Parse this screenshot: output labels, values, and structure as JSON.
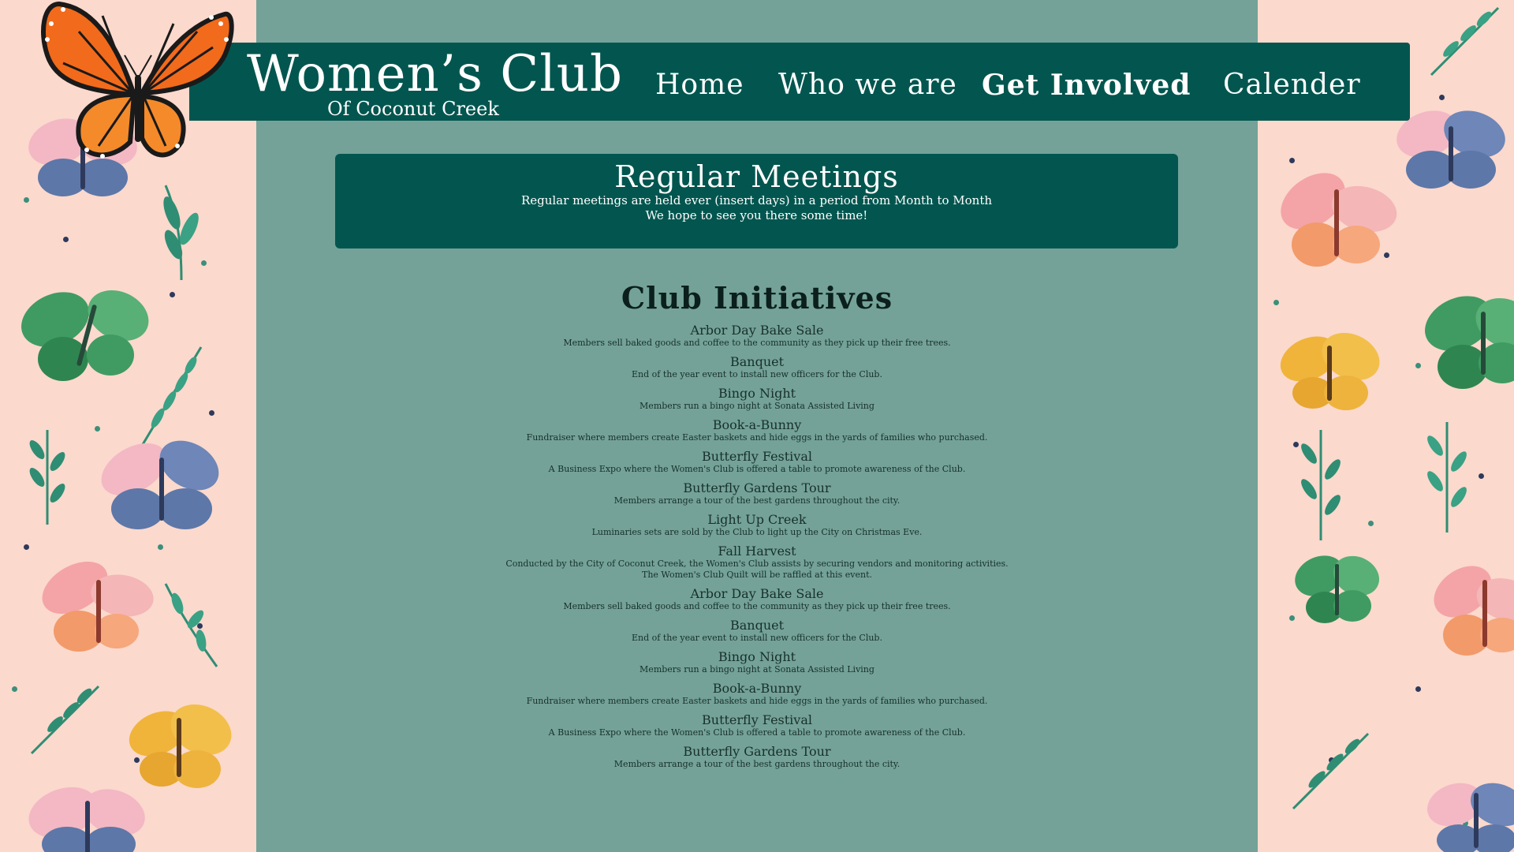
{
  "header": {
    "title": "Women’s Club",
    "subtitle": "Of Coconut Creek",
    "nav": [
      {
        "label": "Home",
        "active": false
      },
      {
        "label": "Who we are",
        "active": false
      },
      {
        "label": "Get Involved",
        "active": true
      },
      {
        "label": "Calender",
        "active": false
      }
    ]
  },
  "meetings": {
    "title": "Regular Meetings",
    "line1": "Regular meetings are held ever (insert days) in a period from Month to Month",
    "line2": "We hope to see you there some time!"
  },
  "initiatives": {
    "title": "Club Initiatives",
    "items": [
      {
        "name": "Arbor Day Bake Sale",
        "desc": "Members sell baked goods and coffee to the community as they pick up their free trees."
      },
      {
        "name": "Banquet",
        "desc": "End of the year event to install new officers for the Club."
      },
      {
        "name": "Bingo Night",
        "desc": "Members run a bingo night at Sonata Assisted Living"
      },
      {
        "name": "Book-a-Bunny",
        "desc": "Fundraiser where members create Easter baskets and hide eggs in the yards of families who purchased."
      },
      {
        "name": "Butterfly Festival",
        "desc": "A Business Expo where the Women's Club is offered a table to promote awareness of the Club."
      },
      {
        "name": "Butterfly Gardens Tour",
        "desc": "Members arrange a tour of the best gardens throughout the city."
      },
      {
        "name": "Light Up Creek",
        "desc": "Luminaries sets are sold by the Club to light up the City on Christmas Eve."
      },
      {
        "name": "Fall Harvest",
        "desc": "Conducted by the City of Coconut Creek, the Women's Club assists by securing vendors and monitoring activities. The Women's Club Quilt will be raffled at this event."
      },
      {
        "name": "Arbor Day Bake Sale",
        "desc": "Members sell baked goods and coffee to the community as they pick up their free trees."
      },
      {
        "name": "Banquet",
        "desc": "End of the year event to install new officers for the Club."
      },
      {
        "name": "Bingo Night",
        "desc": "Members run a bingo night at Sonata Assisted Living"
      },
      {
        "name": "Book-a-Bunny",
        "desc": "Fundraiser where members create Easter baskets and hide eggs in the yards of families who purchased."
      },
      {
        "name": "Butterfly Festival",
        "desc": "A Business Expo where the Women's Club is offered a table to promote awareness of the Club."
      },
      {
        "name": "Butterfly Gardens Tour",
        "desc": "Members arrange a tour of the best gardens throughout the city."
      }
    ]
  },
  "colors": {
    "background_pink": "#fbd9cd",
    "content_teal": "#74a298",
    "header_teal": "#02564f"
  }
}
